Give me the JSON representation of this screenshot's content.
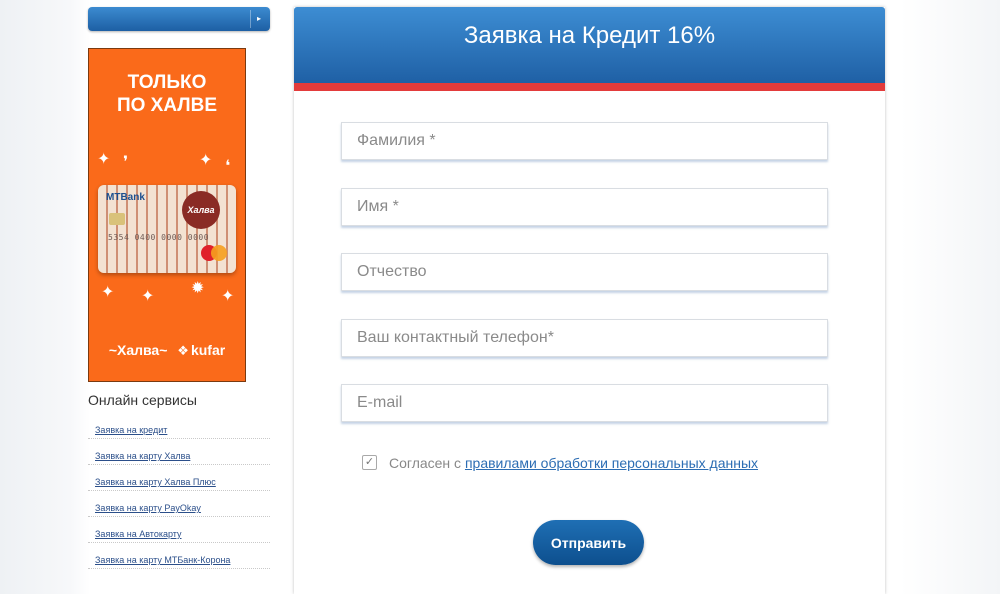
{
  "banner": {
    "headline_line1": "ТОЛЬКО",
    "headline_line2": "ПО ХАЛВЕ",
    "card_bank": "MTBank",
    "card_brand": "Халва",
    "card_number": "5354 0400 0000 0000",
    "footer_brand1": "~Халва~",
    "footer_brand2": "kufar"
  },
  "services": {
    "title": "Онлайн сервисы",
    "links": [
      "Заявка на кредит",
      "Заявка на карту Халва",
      "Заявка на карту Халва Плюс",
      "Заявка на карту PayOkay",
      "Заявка на Автокарту",
      "Заявка на карту МТБанк-Корона"
    ]
  },
  "form": {
    "title": "Заявка на Кредит 16%",
    "fields": {
      "surname_placeholder": "Фамилия *",
      "name_placeholder": "Имя *",
      "patronymic_placeholder": "Отчество",
      "phone_placeholder": "Ваш контактный телефон*",
      "email_placeholder": "E-mail"
    },
    "consent_checked": true,
    "consent_prefix": "Согласен с ",
    "consent_link": "правилами обработки персональных данных",
    "submit_label": "Отправить"
  },
  "colors": {
    "header_blue": "#2a74bd",
    "accent_red": "#e33b3b",
    "banner_orange": "#fa6a1a"
  }
}
